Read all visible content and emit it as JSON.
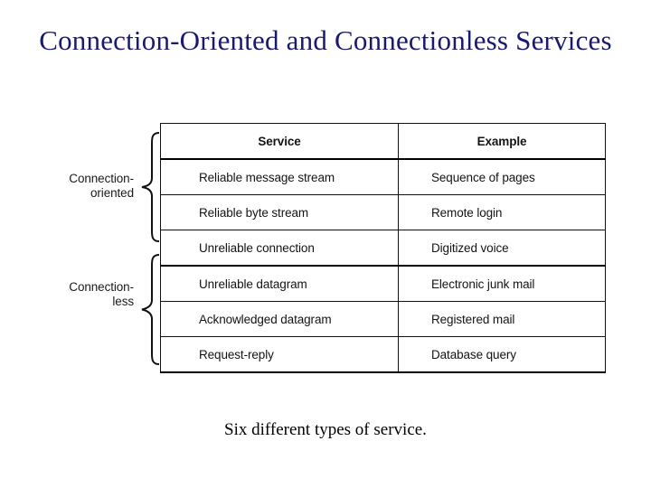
{
  "slide": {
    "title": "Connection-Oriented and Connectionless Services",
    "title_color": "#191970",
    "caption": "Six different types of service."
  },
  "groups": [
    {
      "id": "connection-oriented",
      "label_line1": "Connection-",
      "label_line2": "oriented",
      "rows": 3
    },
    {
      "id": "connectionless",
      "label_line1": "Connection-",
      "label_line2": "less",
      "rows": 3
    }
  ],
  "table": {
    "headers": [
      "Service",
      "Example"
    ],
    "rows": [
      {
        "service": "Reliable message stream",
        "example": "Sequence of pages",
        "group": "connection-oriented"
      },
      {
        "service": "Reliable byte stream",
        "example": "Remote login",
        "group": "connection-oriented"
      },
      {
        "service": "Unreliable connection",
        "example": "Digitized voice",
        "group": "connection-oriented"
      },
      {
        "service": "Unreliable datagram",
        "example": "Electronic junk mail",
        "group": "connectionless"
      },
      {
        "service": "Acknowledged datagram",
        "example": "Registered mail",
        "group": "connectionless"
      },
      {
        "service": "Request-reply",
        "example": "Database query",
        "group": "connectionless"
      }
    ]
  }
}
